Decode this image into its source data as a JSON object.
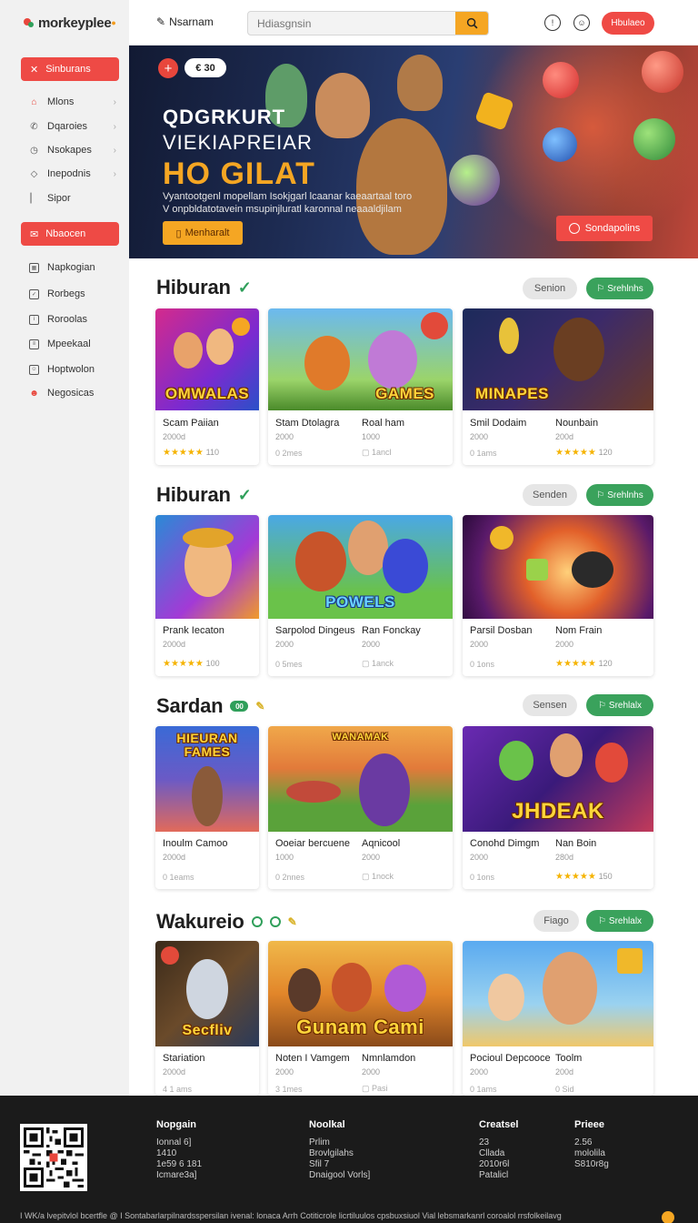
{
  "header": {
    "logo": "morkeyplee",
    "user_link": "Nsarnam",
    "search_placeholder": "Hdiasgnsin",
    "login_label": "Hbulaeo"
  },
  "sidebar": {
    "section1": "Sinburans",
    "items1": [
      "Mlons",
      "Dqaroies",
      "Nsokapes",
      "Inepodnis",
      "Sipor"
    ],
    "section2": "Nbaocen",
    "items2": [
      "Napkogian",
      "Rorbegs",
      "Roroolas",
      "Mpeekaal",
      "Hoptwolon",
      "Negosicas"
    ]
  },
  "hero": {
    "badge": "€ 30",
    "line1": "QDGRKURT",
    "line2": "VIEKIAPREIAR",
    "line3": "HO GILAT",
    "sub1": "Vyantootgenl mopellam Isokjgarl lcaanar kaeaartaal toro",
    "sub2": "V onpbldatotavein msupinjluratl karonnal neaaaldjilam",
    "cta_left": "Menharalt",
    "cta_right": "Sondapolins"
  },
  "sections": [
    {
      "title": "Hiburan",
      "gray_pill": "Senion",
      "green_pill": "Srehlnhs",
      "cards": [
        {
          "art": "OMWALAS",
          "cols": [
            {
              "name": "Scam Paiian",
              "price": "2000d",
              "stars": "★★★★★",
              "count": "110"
            }
          ]
        },
        {
          "art": "GAMES",
          "cols": [
            {
              "name": "Stam Dtolagra",
              "price": "2000",
              "meta": "0 2mes"
            },
            {
              "name": "Roal ham",
              "price": "1000",
              "meta": "▢ 1ancl"
            }
          ]
        },
        {
          "art": "MINAPES",
          "cols": [
            {
              "name": "Smil Dodaim",
              "price": "2000",
              "meta": "0 1ams"
            },
            {
              "name": "Nounbain",
              "price": "200d",
              "stars": "★★★★★",
              "count": "120"
            }
          ]
        }
      ]
    },
    {
      "title": "Hiburan",
      "gray_pill": "Senden",
      "green_pill": "Srehlnhs",
      "cards": [
        {
          "art": "",
          "cols": [
            {
              "name": "Prank Iecaton",
              "price": "2000d",
              "stars": "★★★★★",
              "count": "100"
            }
          ]
        },
        {
          "art": "POWELS",
          "cols": [
            {
              "name": "Sarpolod Dingeus",
              "price": "2000",
              "meta": "0 5mes"
            },
            {
              "name": "Ran Fonckay",
              "price": "2000",
              "meta": "▢ 1anck"
            }
          ]
        },
        {
          "art": "",
          "cols": [
            {
              "name": "Parsil Dosban",
              "price": "2000",
              "meta": "0 1ons"
            },
            {
              "name": "Nom Frain",
              "price": "2000",
              "stars": "★★★★★",
              "count": "120"
            }
          ]
        }
      ]
    },
    {
      "title": "Sardan",
      "gray_pill": "Sensen",
      "green_pill": "Srehlalx",
      "cards": [
        {
          "art": "HIEURAN FAMES",
          "cols": [
            {
              "name": "Inoulm Camoo",
              "price": "2000d",
              "meta": "0 1eams"
            }
          ]
        },
        {
          "art": "WANAMAK",
          "cols": [
            {
              "name": "Ooeiar bercuene",
              "price": "1000",
              "meta": "0 2nnes"
            },
            {
              "name": "Aqnicool",
              "price": "2000",
              "meta": "▢ 1nock"
            }
          ]
        },
        {
          "art": "JHDEAK",
          "cols": [
            {
              "name": "Conohd Dimgm",
              "price": "2000",
              "meta": "0 1ons"
            },
            {
              "name": "Nan Boin",
              "price": "280d",
              "stars": "★★★★★",
              "count": "150"
            }
          ]
        }
      ]
    },
    {
      "title": "Wakureio",
      "gray_pill": "Fiago",
      "green_pill": "Srehlalx",
      "cards": [
        {
          "art": "Secfliv",
          "cols": [
            {
              "name": "Stariation",
              "price": "2000d",
              "meta": "4 1 ams"
            }
          ]
        },
        {
          "art": "Gunam Cami",
          "cols": [
            {
              "name": "Noten I Vamgem",
              "price": "2000",
              "meta": "3 1mes"
            },
            {
              "name": "Nmnlamdon",
              "price": "2000",
              "meta": "▢ Pasi"
            }
          ]
        },
        {
          "art": "",
          "cols": [
            {
              "name": "Pocioul Depcooce",
              "price": "2000",
              "meta": "0 1ams"
            },
            {
              "name": "Toolm",
              "price": "200d",
              "meta": "0 Sid"
            }
          ]
        }
      ]
    }
  ],
  "footer": {
    "cols": [
      {
        "title": "Nopgain",
        "items": [
          "Ionnal 6]",
          "1410",
          "1e59 6 181",
          "Icmare3a]"
        ]
      },
      {
        "title": "Noolkal",
        "items": [
          "Prlim",
          "Brovlgilahs",
          "Sfil 7",
          "Dnaigool Vorls]"
        ]
      },
      {
        "title": "Creatsel",
        "items": [
          "23",
          "Cllada",
          "2010r6l",
          "Patalicl"
        ]
      },
      {
        "title": "Prieee",
        "items": [
          "2.56",
          "mololila",
          "S810r8g"
        ]
      }
    ],
    "bottom_text": "I WK/a lvepitvlol bcertfle @ I Sontabarlarpilnardsspersilan ivenal: lonaca Arrh Cotiticrole licrtiluulos cpsbuxsiuol Vial lebsmarkanrl coroalol rrsfolkeilavg"
  }
}
